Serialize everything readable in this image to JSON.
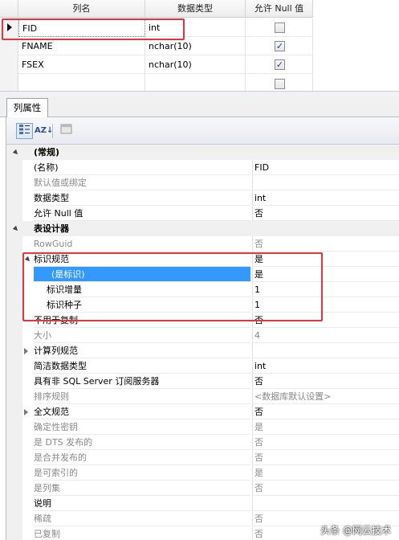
{
  "grid": {
    "headers": [
      "列名",
      "数据类型",
      "允许 Null 值"
    ],
    "rows": [
      {
        "name": "FID",
        "type": "int",
        "nullable": false
      },
      {
        "name": "FNAME",
        "type": "nchar(10)",
        "nullable": true
      },
      {
        "name": "FSEX",
        "type": "nchar(10)",
        "nullable": true
      },
      {
        "name": "",
        "type": "",
        "nullable": false
      }
    ]
  },
  "tab": {
    "label": "列属性"
  },
  "toolbar": {
    "sort_az": "AZ↓",
    "categorized": "☰",
    "pages": "▭"
  },
  "properties": [
    {
      "kind": "cat",
      "name": "(常规)",
      "value": "",
      "expander": "open"
    },
    {
      "kind": "prop",
      "name": "(名称)",
      "value": "FID"
    },
    {
      "kind": "dim",
      "name": "默认值或绑定",
      "value": ""
    },
    {
      "kind": "prop",
      "name": "数据类型",
      "value": "int"
    },
    {
      "kind": "prop",
      "name": "允许 Null 值",
      "value": "否"
    },
    {
      "kind": "cat",
      "name": "表设计器",
      "value": "",
      "expander": "open"
    },
    {
      "kind": "dim",
      "name": "RowGuid",
      "value": "否"
    },
    {
      "kind": "prop",
      "name": "标识规范",
      "value": "是",
      "expander": "open"
    },
    {
      "kind": "child-sel",
      "name": "(是标识)",
      "value": "是"
    },
    {
      "kind": "child",
      "name": "标识增量",
      "value": "1"
    },
    {
      "kind": "child",
      "name": "标识种子",
      "value": "1"
    },
    {
      "kind": "prop",
      "name": "不用于复制",
      "value": "否"
    },
    {
      "kind": "dim",
      "name": "大小",
      "value": "4"
    },
    {
      "kind": "prop",
      "name": "计算列规范",
      "value": "",
      "expander": "closed"
    },
    {
      "kind": "prop",
      "name": "简洁数据类型",
      "value": "int"
    },
    {
      "kind": "prop",
      "name": "具有非 SQL Server 订阅服务器",
      "value": "否"
    },
    {
      "kind": "dim",
      "name": "排序规则",
      "value": "<数据库默认设置>"
    },
    {
      "kind": "prop",
      "name": "全文规范",
      "value": "否",
      "expander": "closed"
    },
    {
      "kind": "dim",
      "name": "确定性密钥",
      "value": "是"
    },
    {
      "kind": "dim",
      "name": "是 DTS 发布的",
      "value": "否"
    },
    {
      "kind": "dim",
      "name": "是合并发布的",
      "value": "否"
    },
    {
      "kind": "dim",
      "name": "是可索引的",
      "value": "是"
    },
    {
      "kind": "dim",
      "name": "是列集",
      "value": "否"
    },
    {
      "kind": "cat",
      "name": "说明",
      "value": ""
    },
    {
      "kind": "dim",
      "name": "稀疏",
      "value": "否"
    },
    {
      "kind": "dim",
      "name": "已复制",
      "value": "否"
    }
  ],
  "watermark": "头条 @网云技术",
  "colors": {
    "highlight": "#e8323c",
    "selection": "#3399ff"
  }
}
